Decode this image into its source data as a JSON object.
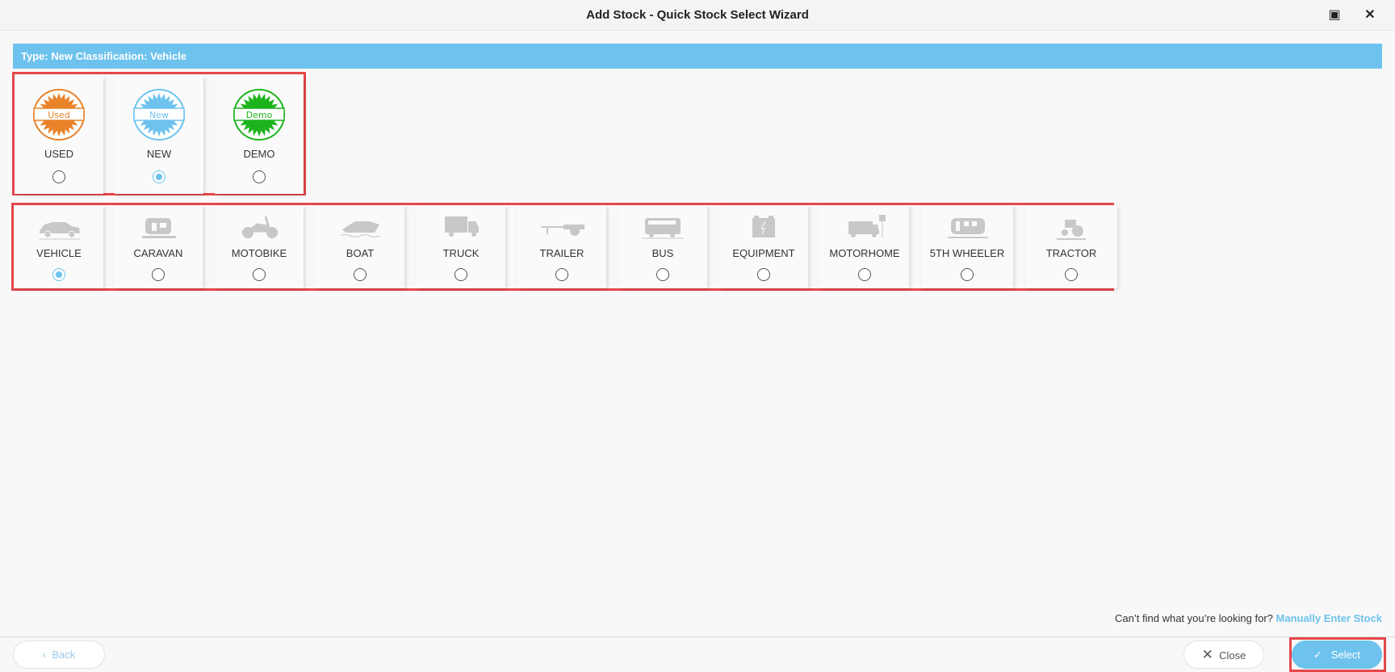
{
  "window": {
    "title": "Add Stock - Quick Stock Select Wizard"
  },
  "info_bar": "Type: New Classification: Vehicle",
  "types": [
    {
      "label": "USED",
      "badge": "Used",
      "color": "#e8832a",
      "selected": false
    },
    {
      "label": "NEW",
      "badge": "New",
      "color": "#6dc3ee",
      "selected": true
    },
    {
      "label": "DEMO",
      "badge": "Demo",
      "color": "#1db31d",
      "selected": false
    }
  ],
  "classifications": [
    {
      "label": "VEHICLE",
      "icon": "car-icon",
      "selected": true
    },
    {
      "label": "CARAVAN",
      "icon": "caravan-icon",
      "selected": false
    },
    {
      "label": "MOTOBIKE",
      "icon": "motorbike-icon",
      "selected": false
    },
    {
      "label": "BOAT",
      "icon": "boat-icon",
      "selected": false
    },
    {
      "label": "TRUCK",
      "icon": "truck-icon",
      "selected": false
    },
    {
      "label": "TRAILER",
      "icon": "trailer-icon",
      "selected": false
    },
    {
      "label": "BUS",
      "icon": "bus-icon",
      "selected": false
    },
    {
      "label": "EQUIPMENT",
      "icon": "battery-icon",
      "selected": false
    },
    {
      "label": "MOTORHOME",
      "icon": "motorhome-icon",
      "selected": false
    },
    {
      "label": "5TH WHEELER",
      "icon": "fifth-wheeler-icon",
      "selected": false
    },
    {
      "label": "TRACTOR",
      "icon": "tractor-icon",
      "selected": false
    }
  ],
  "footer": {
    "hint": "Can’t find what you’re looking for?",
    "link": "Manually Enter Stock",
    "back": "Back",
    "close": "Close",
    "select": "Select"
  }
}
